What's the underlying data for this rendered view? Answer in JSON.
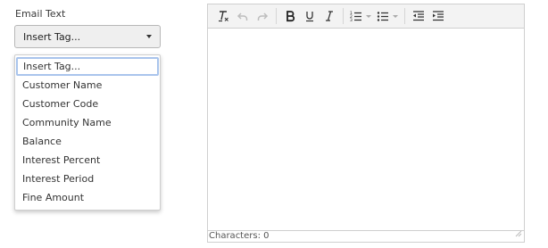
{
  "field": {
    "label": "Email Text",
    "select_value": "Insert Tag..."
  },
  "dropdown": {
    "options": [
      "Insert Tag...",
      "Customer Name",
      "Customer Code",
      "Community Name",
      "Balance",
      "Interest Percent",
      "Interest Period",
      "Fine Amount"
    ],
    "selected": "Insert Tag..."
  },
  "editor": {
    "toolbar": [
      "clear-formatting-icon",
      "undo-icon",
      "redo-icon",
      "bold-icon",
      "underline-icon",
      "italic-icon",
      "ordered-list-icon",
      "unordered-list-icon",
      "outdent-icon",
      "indent-icon"
    ],
    "characters_label": "Characters: 0"
  },
  "colors": {
    "focus_outline": "#a9c4ec",
    "toolbar_bg": "#f3f3f3",
    "border": "#cfcfcf"
  }
}
